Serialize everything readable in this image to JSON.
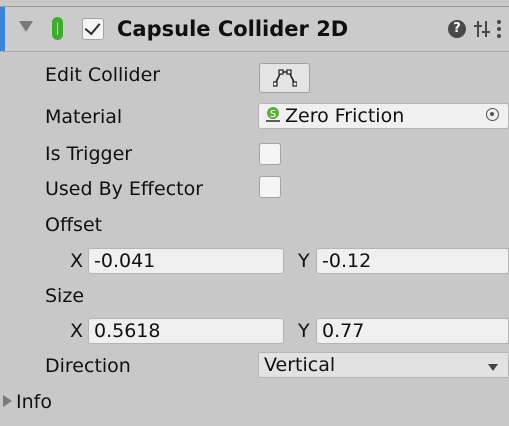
{
  "component": {
    "title": "Capsule Collider 2D",
    "enabled": true,
    "expanded": true,
    "accent_color": "#3d84d8",
    "icon": "capsule-collider-icon",
    "icon_color": "#3dae2b",
    "help_icon_glyph": "?",
    "help_icon": "help-icon",
    "presets_icon": "presets-icon",
    "menu_icon": "kebab-menu-icon"
  },
  "fields": {
    "edit_collider": {
      "label": "Edit Collider",
      "icon": "edit-collider-icon"
    },
    "material": {
      "label": "Material",
      "value": "Zero Friction",
      "icon": "physics-material-icon",
      "picker_icon": "object-picker-icon"
    },
    "is_trigger": {
      "label": "Is Trigger",
      "checked": false
    },
    "used_by_effector": {
      "label": "Used By Effector",
      "checked": false
    },
    "offset": {
      "label": "Offset",
      "x_label": "X",
      "x_value": "-0.041",
      "y_label": "Y",
      "y_value": "-0.12"
    },
    "size": {
      "label": "Size",
      "x_label": "X",
      "x_value": "0.5618",
      "y_label": "Y",
      "y_value": "0.77"
    },
    "direction": {
      "label": "Direction",
      "value": "Vertical",
      "options_icon": "dropdown-arrow-icon"
    }
  },
  "info": {
    "label": "Info",
    "expanded": false
  }
}
